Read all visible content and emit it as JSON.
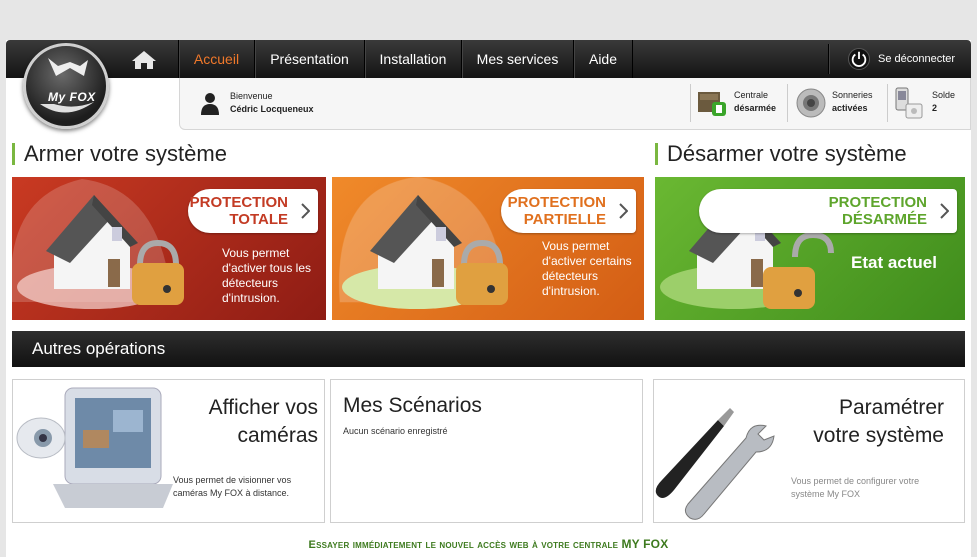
{
  "nav": {
    "logo_text": "My FOX",
    "items": [
      {
        "label": "Accueil",
        "active": true
      },
      {
        "label": "Présentation"
      },
      {
        "label": "Installation"
      },
      {
        "label": "Mes services"
      },
      {
        "label": "Aide"
      }
    ],
    "logout_label": "Se déconnecter"
  },
  "welcome": {
    "greeting": "Bienvenue",
    "user_name": "Cédric Locqueneux",
    "stats": [
      {
        "label": "Centrale",
        "value": "désarmée",
        "icon": "alarm-box-icon"
      },
      {
        "label": "Sonneries",
        "value": "activées",
        "icon": "siren-icon"
      },
      {
        "label": "Solde",
        "value": "2",
        "icon": "phone-icon"
      }
    ]
  },
  "arm": {
    "title": "Armer votre système",
    "total": {
      "title_line1": "PROTECTION",
      "title_line2": "TOTALE",
      "desc": [
        "Vous permet",
        "d'activer tous les",
        "détecteurs",
        "d'intrusion."
      ]
    },
    "partial": {
      "title_line1": "PROTECTION",
      "title_line2": "PARTIELLE",
      "desc": [
        "Vous permet",
        "d'activer certains",
        "détecteurs",
        "d'intrusion."
      ]
    }
  },
  "disarm": {
    "title": "Désarmer votre système",
    "card": {
      "title_line1": "PROTECTION",
      "title_line2": "DÉSARMÉE",
      "status": "Etat actuel"
    }
  },
  "other": {
    "title": "Autres opérations",
    "cameras": {
      "title_line1": "Afficher vos",
      "title_line2": "caméras",
      "desc_line1": "Vous permet de visionner vos",
      "desc_line2": "caméras My FOX à distance."
    },
    "scenarios": {
      "title": "Mes Scénarios",
      "desc": "Aucun scénario enregistré"
    },
    "settings": {
      "title_line1": "Paramétrer",
      "title_line2": "votre système",
      "desc_line1": "Vous permet de configurer votre",
      "desc_line2": "système My FOX"
    }
  },
  "footer": {
    "text": "Essayer immédiatement le nouvel accès web à votre centrale",
    "brand": "MY FOX"
  },
  "colors": {
    "accent_orange": "#f0782a",
    "green": "#7ab740",
    "red_tile": "#b8281c",
    "orange_tile": "#e8731d",
    "green_tile": "#5faa2a"
  }
}
